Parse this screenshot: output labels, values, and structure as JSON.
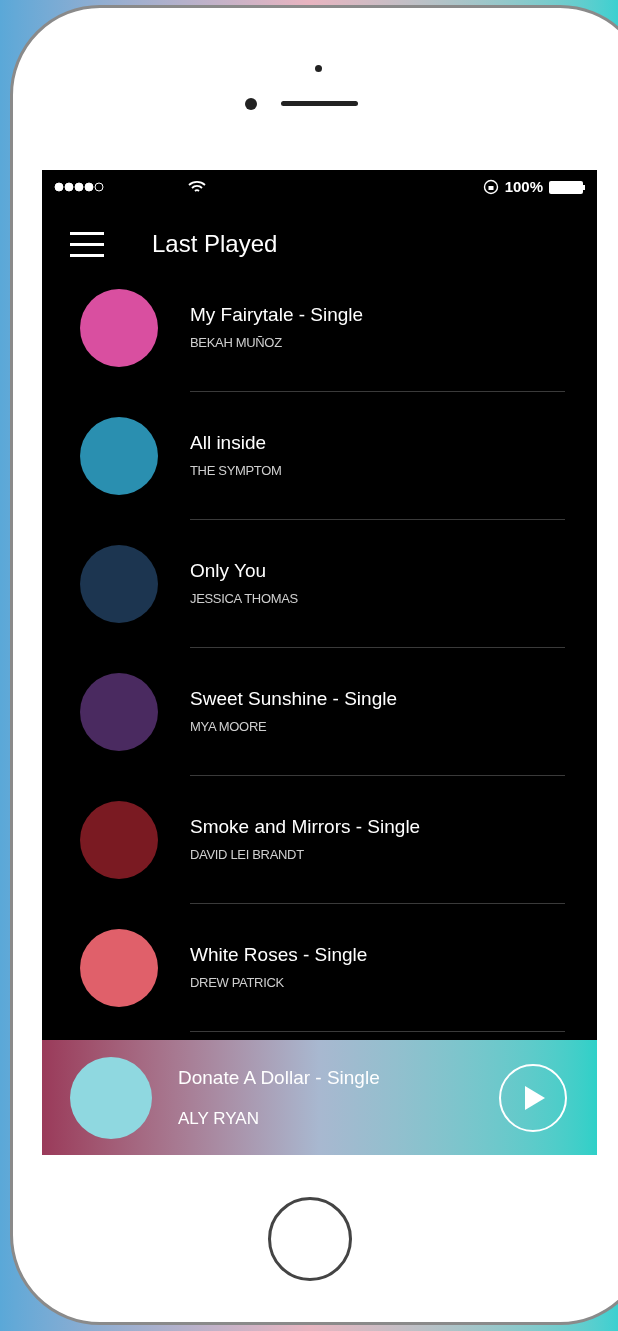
{
  "status_bar": {
    "battery": "100%"
  },
  "header": {
    "title": "Last Played"
  },
  "tracks": [
    {
      "title": "My Fairytale - Single",
      "artist": "BEKAH MUÑOZ",
      "color": "#d94fa0"
    },
    {
      "title": "All inside",
      "artist": "THE SYMPTOM",
      "color": "#2a8fb0"
    },
    {
      "title": "Only You",
      "artist": "JESSICA THOMAS",
      "color": "#1c3550"
    },
    {
      "title": "Sweet Sunshine - Single",
      "artist": "MYA MOORE",
      "color": "#4a2a60"
    },
    {
      "title": "Smoke and Mirrors - Single",
      "artist": "DAVID LEI BRANDT",
      "color": "#7a1a22"
    },
    {
      "title": "White Roses - Single",
      "artist": "DREW PATRICK",
      "color": "#e0606a"
    }
  ],
  "now_playing": {
    "title": "Donate A Dollar - Single",
    "artist": "ALY RYAN",
    "playing": false
  }
}
